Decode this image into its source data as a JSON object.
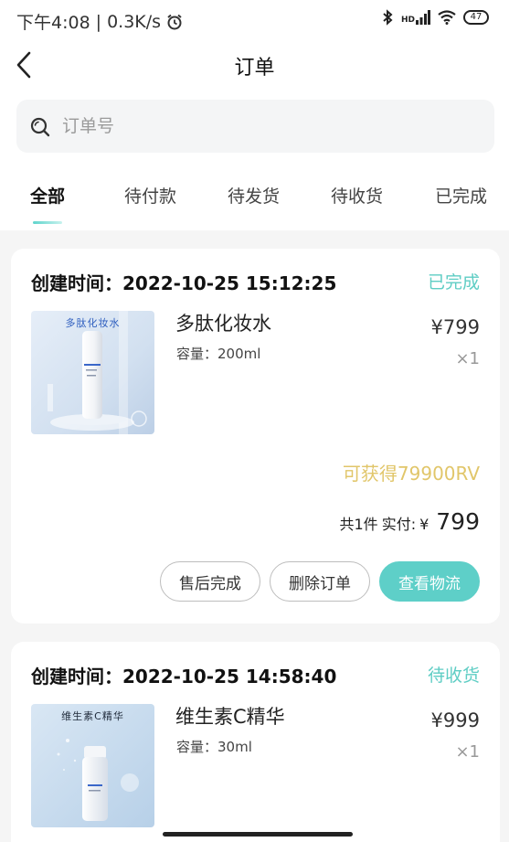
{
  "status_bar": {
    "time": "下午4:08",
    "separator": "|",
    "speed": "0.3K/s",
    "hd_label": "HD",
    "battery": "47"
  },
  "nav": {
    "title": "订单"
  },
  "search": {
    "placeholder": "订单号",
    "value": ""
  },
  "tabs": [
    {
      "label": "全部",
      "active": true
    },
    {
      "label": "待付款",
      "active": false
    },
    {
      "label": "待发货",
      "active": false
    },
    {
      "label": "待收货",
      "active": false
    },
    {
      "label": "已完成",
      "active": false
    }
  ],
  "orders": [
    {
      "created_label": "创建时间：",
      "created_time": "2022-10-25 15:12:25",
      "status": "已完成",
      "product": {
        "image_title": "多肽化妆水",
        "name": "多肽化妆水",
        "spec": "容量：200ml",
        "price": "¥799",
        "qty": "×1"
      },
      "points": "可获得79900RV",
      "summary": {
        "count": "共1件",
        "paid_label": "实付:",
        "currency": "¥",
        "amount": "799"
      },
      "actions": [
        "售后完成",
        "删除订单",
        "查看物流"
      ]
    },
    {
      "created_label": "创建时间：",
      "created_time": "2022-10-25 14:58:40",
      "status": "待收货",
      "product": {
        "image_title": "维生素C精华",
        "name": "维生素C精华",
        "spec": "容量：30ml",
        "price": "¥999",
        "qty": "×1"
      }
    }
  ],
  "colors": {
    "accent": "#5ecfc8",
    "points": "#e1c66a",
    "background": "#f5f5f5"
  }
}
